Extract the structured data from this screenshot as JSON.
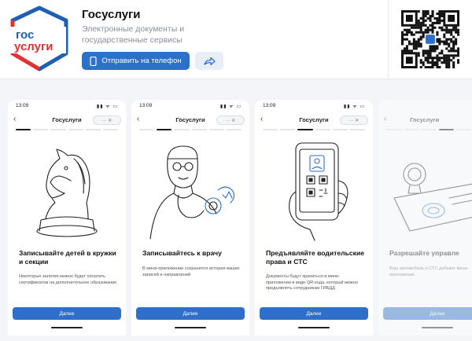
{
  "app": {
    "title": "Госуслуги",
    "subtitle": "Электронные документы и государственные сервисы",
    "logo_line1": "гос",
    "logo_line2": "услуги",
    "send_button": "Отправить на телефон",
    "share_icon": "share-arrow-icon",
    "qr_badge_icon": "vk-icon"
  },
  "colors": {
    "brand_blue": "#2e6fc9",
    "brand_red": "#e4312f",
    "logo_blue": "#1e5fb4"
  },
  "screens": [
    {
      "time": "13:09",
      "nav_title": "Госуслуги",
      "pill": "··· ✕",
      "step": 1,
      "illustration": "chess-knight",
      "title": "Записывайте детей в кружки и секции",
      "desc": "Некоторые занятия можно будет оплатить сертификатом на дополнительное образование",
      "button": "Далее"
    },
    {
      "time": "13:09",
      "nav_title": "Госуслуги",
      "pill": "··· ✕",
      "step": 2,
      "illustration": "doctor",
      "title": "Записывайтесь к врачу",
      "desc": "В мини-приложении сохранится история ваших записей и направлений",
      "button": "Далее"
    },
    {
      "time": "13:09",
      "nav_title": "Госуслуги",
      "pill": "··· ✕",
      "step": 3,
      "illustration": "phone-qr",
      "title": "Предъявляйте водительские права и СТС",
      "desc": "Документы будут храниться в мини-приложении в виде QR-кода, который можно предъявлять сотрудникам ГИБДД",
      "button": "Далее"
    },
    {
      "time": "",
      "nav_title": "Госуслуги",
      "pill": "··· ✕",
      "step": 4,
      "illustration": "car-keys",
      "title": "Разрешайте управле",
      "desc": "Ваш автомобиль и СТС добавят мини-приложение",
      "button": "Далее"
    }
  ],
  "status_icons": "▮▮ ᯤ ▭"
}
